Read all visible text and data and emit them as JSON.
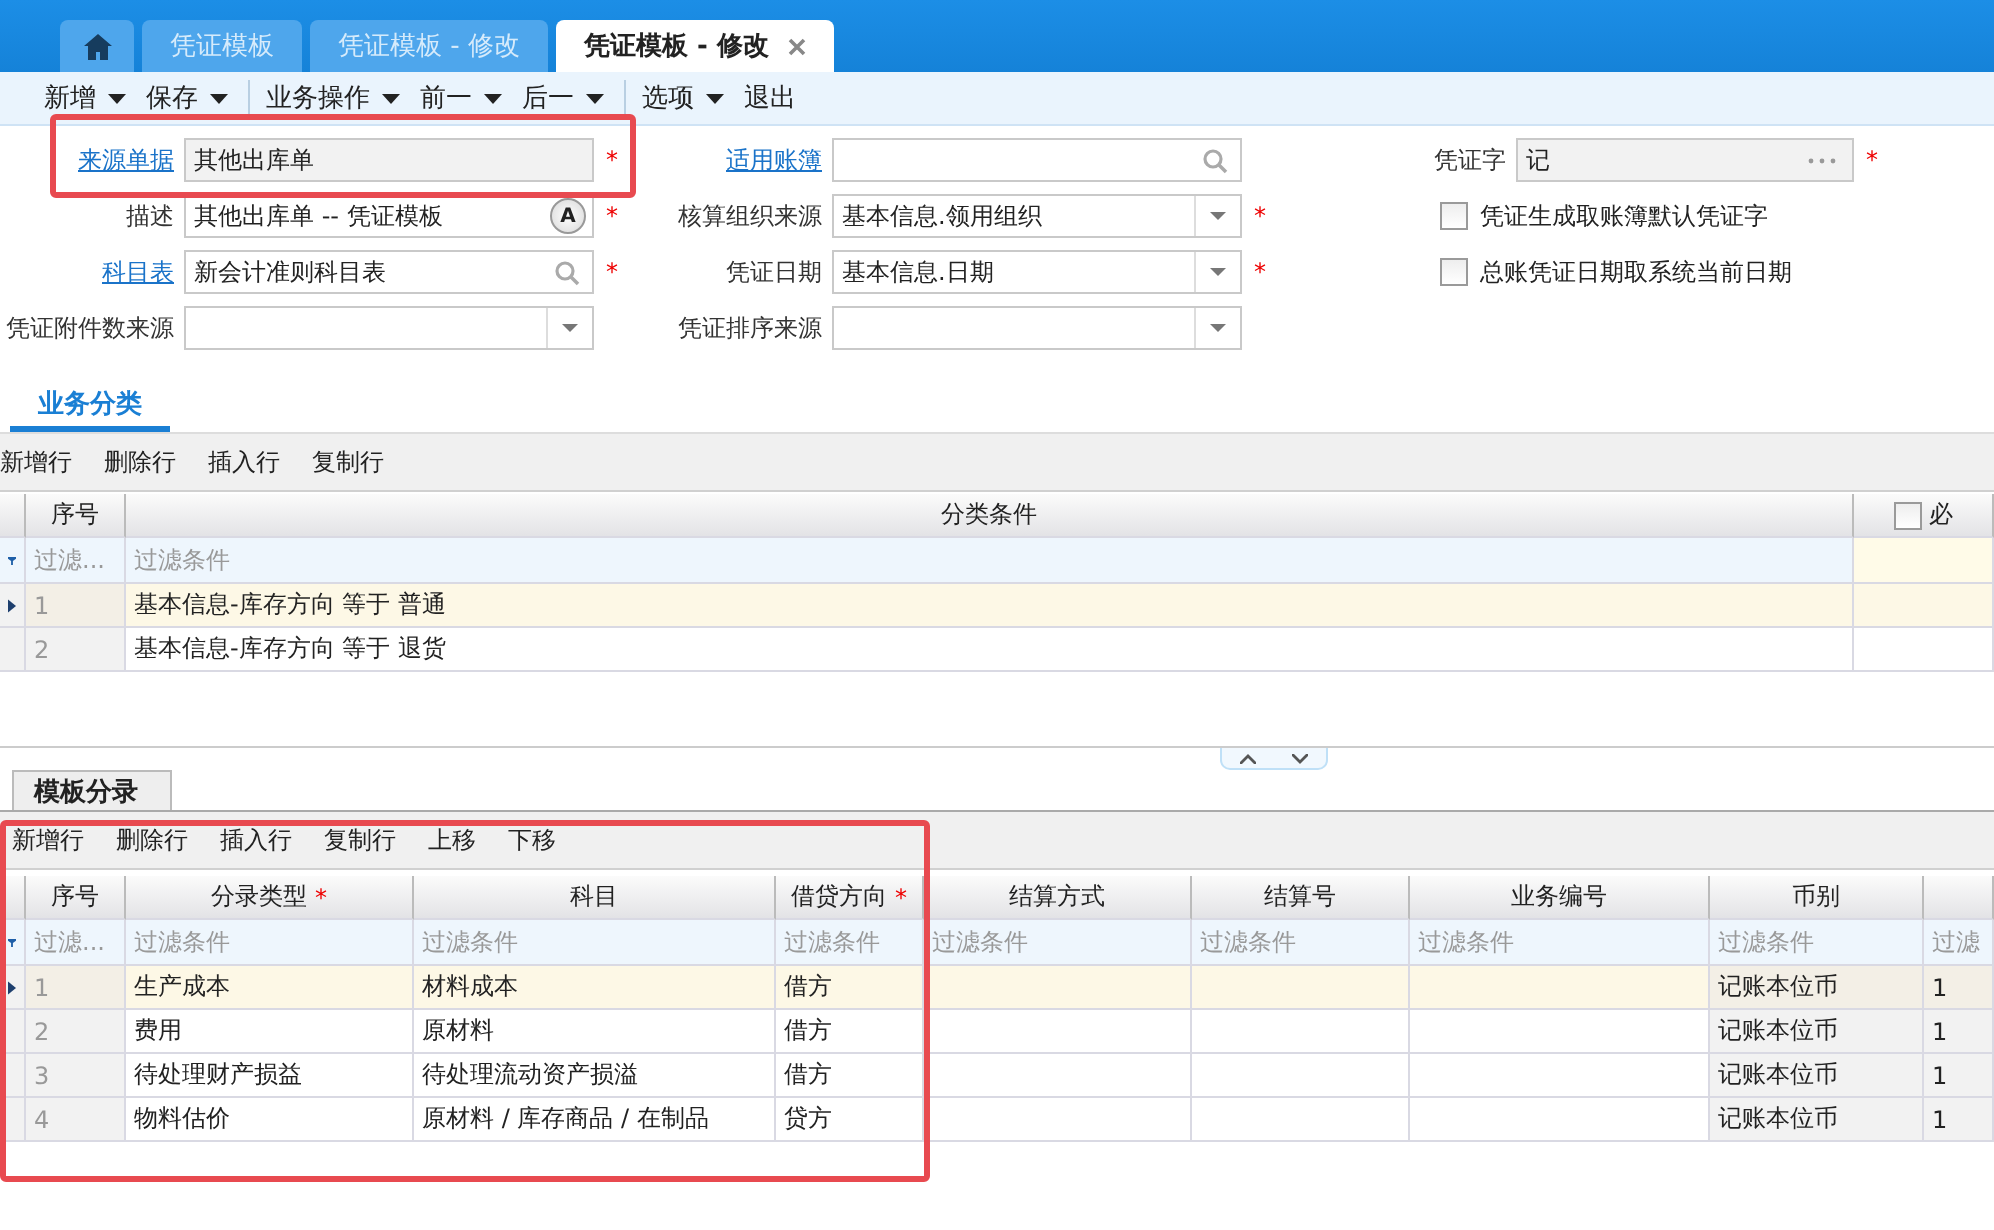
{
  "tabs": [
    {
      "kind": "home",
      "selected": false
    },
    {
      "kind": "page",
      "label": "凭证模板",
      "selected": false,
      "closable": false
    },
    {
      "kind": "page",
      "label": "凭证模板 - 修改",
      "selected": false,
      "closable": false
    },
    {
      "kind": "page",
      "label": "凭证模板 - 修改",
      "selected": true,
      "closable": true
    }
  ],
  "toolbar": [
    {
      "label": "新增",
      "dropdown": true,
      "group_start": false
    },
    {
      "label": "保存",
      "dropdown": true,
      "group_start": false
    },
    {
      "label": "业务操作",
      "dropdown": true,
      "group_start": true
    },
    {
      "label": "前一",
      "dropdown": true,
      "group_start": false
    },
    {
      "label": "后一",
      "dropdown": true,
      "group_start": false
    },
    {
      "label": "选项",
      "dropdown": true,
      "group_start": true
    },
    {
      "label": "退出",
      "dropdown": false,
      "group_start": false
    }
  ],
  "form": {
    "columns": [
      [
        {
          "kind": "text",
          "label": "来源单据",
          "link": true,
          "value": "其他出库单",
          "readonly": true,
          "mark": "*"
        },
        {
          "kind": "text",
          "label": "描述",
          "link": false,
          "value": "其他出库单 -- 凭证模板",
          "button": "A",
          "readonly": false,
          "mark": "*"
        },
        {
          "kind": "search",
          "label": "科目表",
          "link": true,
          "value": "新会计准则科目表",
          "readonly": false,
          "mark": "*"
        },
        {
          "kind": "select",
          "label": "凭证附件数来源",
          "link": false,
          "readonly": false
        }
      ],
      [
        {
          "kind": "search",
          "label": "适用账簿",
          "link": true,
          "readonly": false
        },
        {
          "kind": "select",
          "label": "核算组织来源",
          "link": false,
          "value": "基本信息.领用组织",
          "readonly": false,
          "mark": "*"
        },
        {
          "kind": "select",
          "label": "凭证日期",
          "link": false,
          "value": "基本信息.日期",
          "readonly": false,
          "mark": "*"
        },
        {
          "kind": "select",
          "label": "凭证排序来源",
          "link": false,
          "readonly": false
        }
      ],
      [
        {
          "kind": "ellipsis",
          "label": "凭证字",
          "link": false,
          "value": "记",
          "readonly": true,
          "mark": "*"
        },
        {
          "kind": "checkbox",
          "label": "凭证生成取账簿默认凭证字",
          "checked": false
        },
        {
          "kind": "checkbox",
          "label": "总账凭证日期取系统当前日期",
          "checked": false
        }
      ]
    ]
  },
  "sections": [
    {
      "tab": "业务分类",
      "selected": true,
      "actions": [
        "新增行",
        "删除行",
        "插入行",
        "复制行"
      ],
      "grid": {
        "columns": [
          {
            "label": "序号",
            "readonly": true
          },
          {
            "label": "分类条件",
            "readonly": false
          },
          {
            "label": "必",
            "kind": "checkbox",
            "checked": false,
            "readonly": false
          }
        ],
        "filter_row": [
          "过滤...",
          "过滤条件"
        ],
        "rows": [
          {
            "selected": true,
            "cells": [
              "1",
              "基本信息-库存方向 等于 普通"
            ]
          },
          {
            "selected": false,
            "cells": [
              "2",
              "基本信息-库存方向 等于 退货"
            ]
          }
        ]
      }
    },
    {
      "tab": "模板分录",
      "selected": false,
      "actions": [
        "新增行",
        "删除行",
        "插入行",
        "复制行",
        "上移",
        "下移"
      ],
      "grid": {
        "columns": [
          {
            "label": "序号",
            "readonly": true
          },
          {
            "label": "分录类型",
            "mark": "*",
            "readonly": false
          },
          {
            "label": "科目",
            "readonly": false
          },
          {
            "label": "借贷方向",
            "mark": "*",
            "readonly": false
          },
          {
            "label": "结算方式",
            "readonly": false
          },
          {
            "label": "结算号",
            "readonly": false
          },
          {
            "label": "业务编号",
            "readonly": false
          },
          {
            "label": "币别",
            "readonly": true
          },
          {
            "readonly": true
          }
        ],
        "filter_row": [
          "过滤...",
          "过滤条件",
          "过滤条件",
          "过滤条件",
          "过滤条件",
          "过滤条件",
          "过滤条件",
          "过滤条件",
          "过滤"
        ],
        "rows": [
          {
            "selected": true,
            "cells": [
              "1",
              "生产成本",
              "材料成本",
              "借方",
              null,
              null,
              null,
              "记账本位币",
              "1"
            ]
          },
          {
            "selected": false,
            "cells": [
              "2",
              "费用",
              "原材料",
              "借方",
              null,
              null,
              null,
              "记账本位币",
              "1"
            ]
          },
          {
            "selected": false,
            "cells": [
              "3",
              "待处理财产损益",
              "待处理流动资产损溢",
              "借方",
              null,
              null,
              null,
              "记账本位币",
              "1"
            ]
          },
          {
            "selected": false,
            "cells": [
              "4",
              "物料估价",
              "原材料 / 库存商品 / 在制品",
              "贷方",
              null,
              null,
              null,
              "记账本位币",
              "1"
            ]
          }
        ]
      }
    }
  ]
}
